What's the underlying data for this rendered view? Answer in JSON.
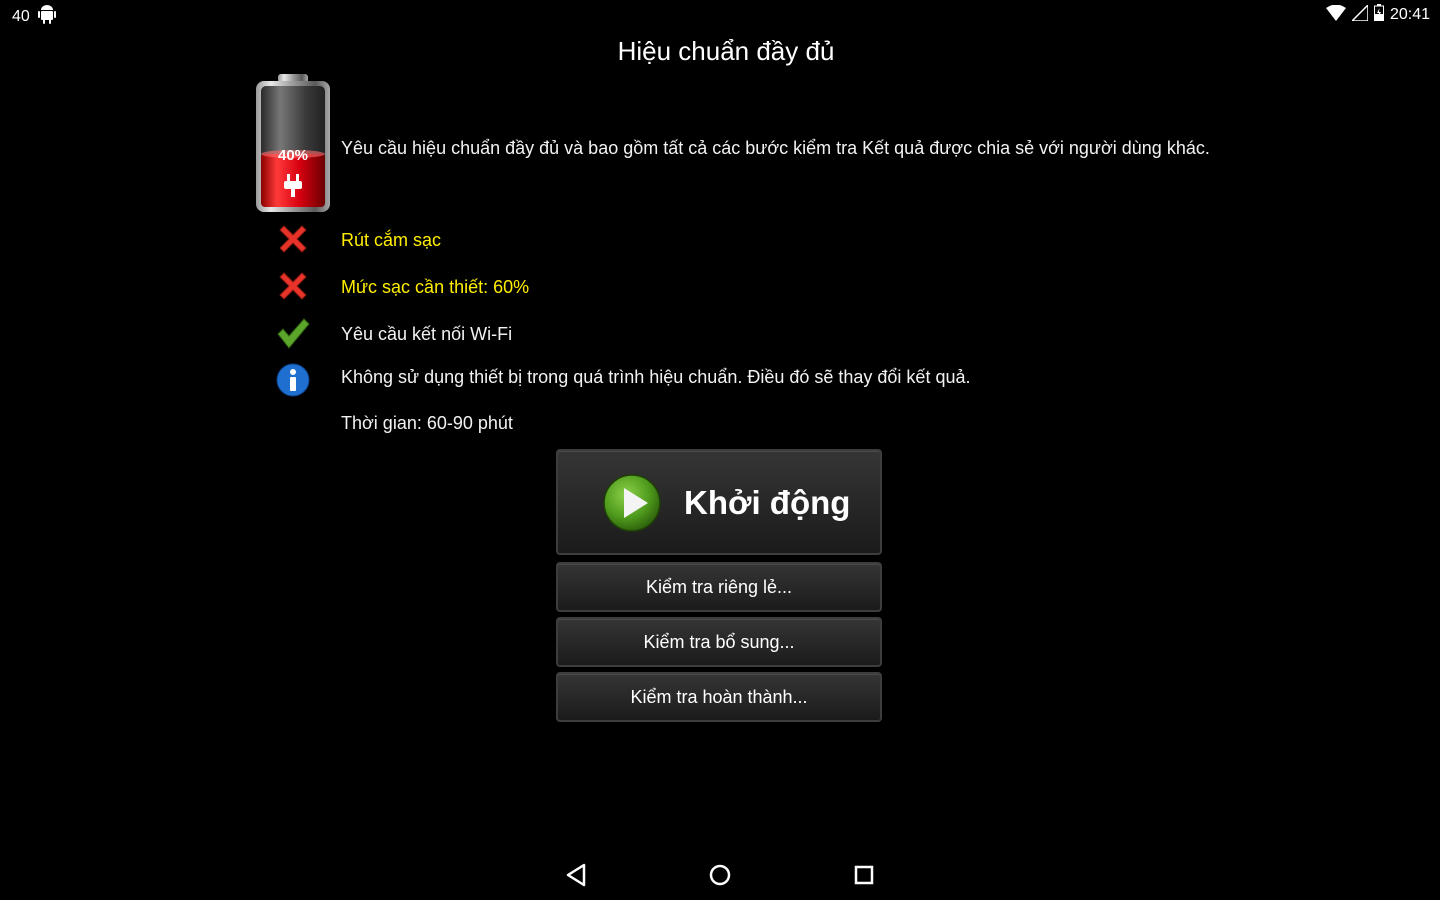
{
  "status_bar": {
    "notification_count": "40",
    "time": "20:41",
    "icons": [
      "android-icon",
      "wifi-icon",
      "signal-icon",
      "battery-charging-icon"
    ]
  },
  "title": "Hiệu chuẩn đầy đủ",
  "battery_graphic": {
    "percent_label": "40%",
    "level": 0.4,
    "fill_color": "#e0101a"
  },
  "description": "Yêu cầu hiệu chuẩn đầy đủ và bao gồm tất cả các bước kiểm tra Kết quả được chia sẻ với người dùng khác.",
  "requirements": [
    {
      "icon": "red-x-icon",
      "text": "Rút cắm sạc",
      "status": "failed"
    },
    {
      "icon": "red-x-icon",
      "text": "Mức sạc cần thiết: 60%",
      "status": "failed"
    },
    {
      "icon": "green-check-icon",
      "text": "Yêu cầu kết nối Wi-Fi",
      "status": "ok"
    },
    {
      "icon": "info-icon",
      "text": "Không sử dụng thiết bị trong quá trình hiệu chuẩn. Điều đó sẽ thay đổi kết quả.",
      "status": "info"
    }
  ],
  "duration": "Thời gian: 60-90 phút",
  "buttons": {
    "start": "Khởi động",
    "individual": "Kiểm tra riêng lẻ...",
    "additional": "Kiểm tra bổ sung...",
    "complete": "Kiểm tra hoàn thành..."
  },
  "colors": {
    "warning_text": "#ffee00",
    "accent_green": "#5aa52a",
    "error_red": "#e8332a"
  }
}
